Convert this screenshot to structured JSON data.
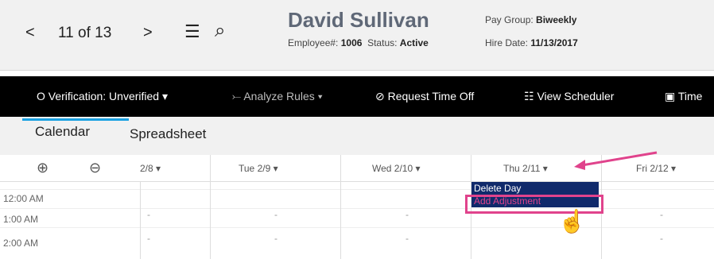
{
  "header": {
    "prev_glyph": "<",
    "counter": "11 of 13",
    "next_glyph": ">",
    "list_glyph": "☰",
    "search_glyph": "⌕",
    "employee_name": "David Sullivan",
    "employee_num_label": "Employee#:",
    "employee_num": "1006",
    "status_label": "Status:",
    "status": "Active",
    "pay_group_label": "Pay Group:",
    "pay_group": "Biweekly",
    "hire_date_label": "Hire Date:",
    "hire_date": "11/13/2017"
  },
  "toolbar": {
    "verification": "O Verification: Unverified ▾",
    "analyze": "⤚ Analyze Rules ▾",
    "request": "⊘ Request Time Off",
    "scheduler": "☷ View Scheduler",
    "time": "▣ Time"
  },
  "tabs": [
    "Calendar",
    "Spreadsheet"
  ],
  "grid": {
    "zoom_in": "⊕",
    "zoom_out": "⊖",
    "days": [
      "2/8 ▾",
      "Tue 2/9 ▾",
      "Wed 2/10 ▾",
      "Thu 2/11 ▾",
      "Fri 2/12 ▾"
    ],
    "times": [
      "12:00 AM",
      "1:00 AM",
      "2:00 AM"
    ],
    "cell": "-"
  },
  "context_menu": {
    "items": [
      "Delete Day",
      "Add Adjustment"
    ]
  },
  "colors": {
    "accent": "#1ba1e2",
    "highlight": "#e0438c",
    "menu_bg": "#102a6b"
  }
}
